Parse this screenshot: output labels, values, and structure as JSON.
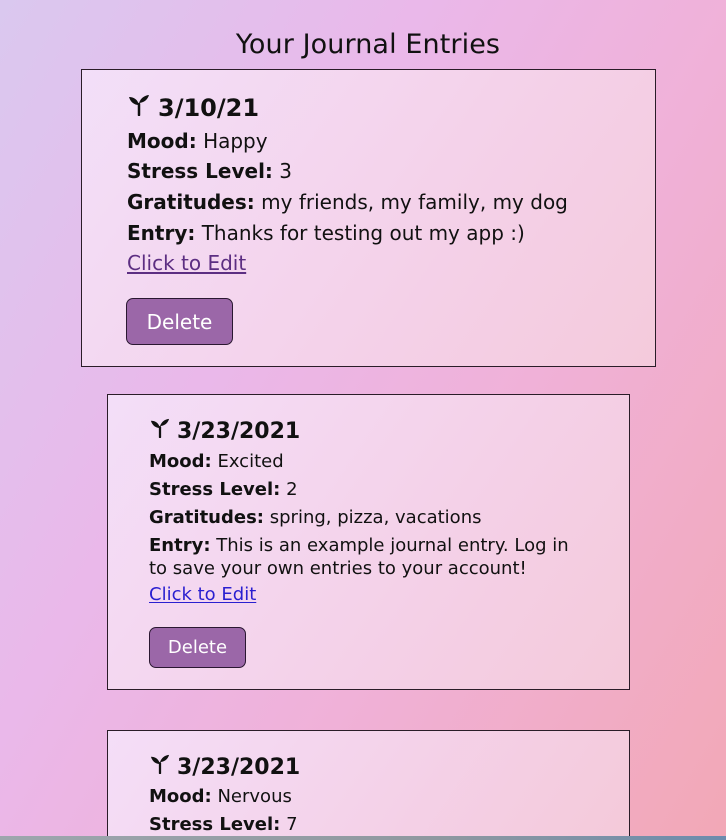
{
  "page": {
    "title": "Your Journal Entries"
  },
  "entries": [
    {
      "date": "3/10/21",
      "mood_label": "Mood:",
      "mood": "Happy",
      "stress_label": "Stress Level:",
      "stress": "3",
      "gratitudes_label": "Gratitudes:",
      "gratitudes": "my friends, my family, my dog",
      "entry_label": "Entry:",
      "entry": "Thanks for testing out my app :)",
      "edit_link": "Click to Edit",
      "delete_button": "Delete"
    },
    {
      "date": "3/23/2021",
      "mood_label": "Mood:",
      "mood": "Excited",
      "stress_label": "Stress Level:",
      "stress": "2",
      "gratitudes_label": "Gratitudes:",
      "gratitudes": "spring, pizza, vacations",
      "entry_label": "Entry:",
      "entry": "This is an example journal entry. Log in to save your own entries to your account!",
      "edit_link": "Click to Edit",
      "delete_button": "Delete"
    },
    {
      "date": "3/23/2021",
      "mood_label": "Mood:",
      "mood": "Nervous",
      "stress_label": "Stress Level:",
      "stress": "7"
    }
  ],
  "icons": {
    "entry_icon": "sprout-icon"
  },
  "colors": {
    "background_start": "#dac8ef",
    "background_mid": "#eab8ea",
    "background_end": "#f2a8b6",
    "card_bg": "#f4e1f9",
    "delete_button": "#9b67a8",
    "link_visited": "#5c2e82",
    "link": "#2a1fd0"
  }
}
